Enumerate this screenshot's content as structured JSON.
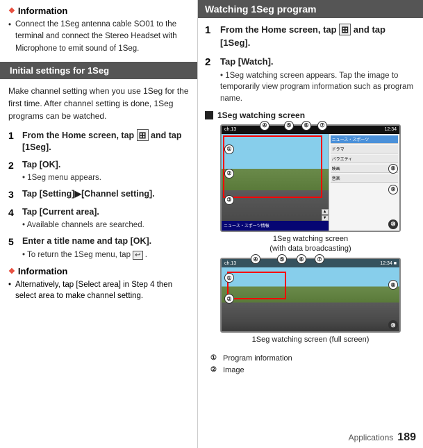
{
  "left": {
    "info_header": "Information",
    "info_diamond": "❖",
    "info_body": "Connect the 1Seg antenna cable SO01 to the terminal and connect the Stereo Headset with Microphone to emit sound of 1Seg.",
    "section_title": "Initial settings for 1Seg",
    "intro_text": "Make channel setting when you use 1Seg for the first time. After channel setting is done, 1Seg programs can be watched.",
    "steps": [
      {
        "num": "1",
        "title": "From the Home screen, tap",
        "title_suffix": " and tap [1Seg].",
        "icon": "⊞",
        "sub": ""
      },
      {
        "num": "2",
        "title": "Tap [OK].",
        "sub": "• 1Seg menu appears."
      },
      {
        "num": "3",
        "title": "Tap [Setting]▶[Channel setting].",
        "sub": ""
      },
      {
        "num": "4",
        "title": "Tap [Current area].",
        "sub": "• Available channels are searched."
      },
      {
        "num": "5",
        "title": "Enter a title name and tap [OK].",
        "sub": "• To return the 1Seg menu, tap ↩ ."
      }
    ],
    "info2_header": "Information",
    "info2_body": "Alternatively, tap [Select area] in Step 4 then select area to make channel setting."
  },
  "right": {
    "header_title": "Watching 1Seg program",
    "steps": [
      {
        "num": "1",
        "title": "From the Home screen, tap",
        "icon": "⊞",
        "title_suffix": " and tap [1Seg].",
        "sub": ""
      },
      {
        "num": "2",
        "title": "Tap [Watch].",
        "sub": "• 1Seg watching screen appears. Tap the image to temporarily view program information such as program name."
      }
    ],
    "watching_label": "1Seg watching screen",
    "screen1_caption": "1Seg watching screen\n(with data broadcasting)",
    "screen2_caption": "1Seg watching screen (full screen)",
    "legend": [
      {
        "num": "①",
        "label": "Program information"
      },
      {
        "num": "②",
        "label": "Image"
      }
    ]
  },
  "footer": {
    "section": "Applications",
    "page_num": "189"
  },
  "icons": {
    "diamond": "❖",
    "black_square": "■",
    "grid_icon": "⊞",
    "back_icon": "↩"
  }
}
